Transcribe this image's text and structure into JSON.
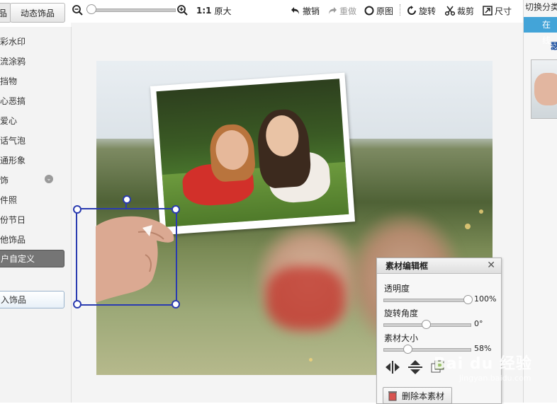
{
  "tabs": {
    "static_partial": "品",
    "dynamic": "动态饰品"
  },
  "categories": [
    "彩水印",
    "流涂鸦",
    "挡物",
    "心恶搞",
    "爱心",
    "话气泡",
    "通形象",
    "饰",
    "件照",
    "份节日",
    "他饰品"
  ],
  "active_category": "户自定义",
  "import_button": "入饰品",
  "toolbar": {
    "zoom_ratio_label": "1:1",
    "original_size": "原大",
    "undo": "撤销",
    "redo": "重做",
    "original_image": "原图",
    "rotate": "旋转",
    "crop": "裁剪",
    "size": "尺寸"
  },
  "editor": {
    "title": "素材编辑框",
    "opacity_label": "透明度",
    "opacity_value": "100%",
    "opacity_level": 1.0,
    "rotation_label": "旋转角度",
    "rotation_value": "0°",
    "rotation_level": 0.5,
    "size_label": "素材大小",
    "size_value": "58%",
    "size_level": 0.28,
    "delete_button": "删除本素材"
  },
  "right_panel": {
    "title": "切换分类",
    "tab": "在线",
    "link": "瑟"
  },
  "watermark": {
    "brand": "Bai du 经验",
    "url": "jingyan.baidu.com"
  },
  "colors": {
    "accent": "#43a4d8",
    "selection": "#2a3bb0",
    "active_category": "#757575"
  }
}
